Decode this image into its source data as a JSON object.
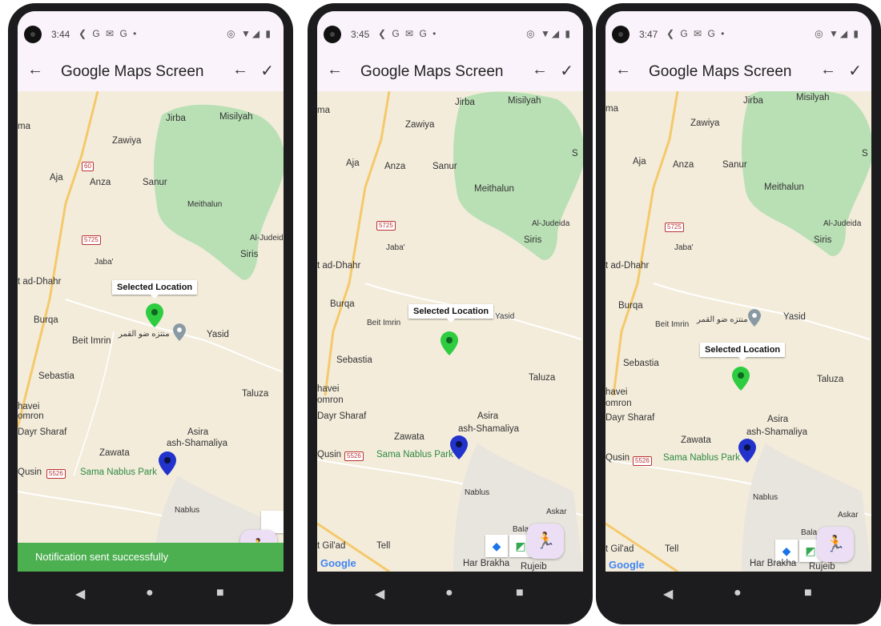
{
  "status": {
    "time1": "3:44",
    "time2": "3:45",
    "time3": "3:47",
    "left_icons": "❮ G ✉ G •",
    "right_icons": "◎ ▼◢ ▮"
  },
  "appbar": {
    "title": "Google Maps Screen",
    "back": "←",
    "back2": "←",
    "check": "✓"
  },
  "map_labels": {
    "ma": "ma",
    "jirba": "Jirba",
    "misilyah": "Misilyah",
    "zawiya": "Zawiya",
    "aja": "Aja",
    "anza": "Anza",
    "sanur": "Sanur",
    "meithalun": "Meithalun",
    "al_judeida": "Al-Judeida",
    "siris": "Siris",
    "jaba": "Jaba'",
    "t_ad_dhahr": "t ad-Dhahr",
    "burqa": "Burqa",
    "beit_imrin": "Beit Imrin",
    "arabic": "منتزه ضو القمر",
    "yasid": "Yasid",
    "sebastia": "Sebastia",
    "taluza": "Taluza",
    "havei": "havei",
    "omron": "omron",
    "dayr_sharaf": "Dayr Sharaf",
    "asira": "Asira",
    "ash_shamaliya": "ash-Shamaliya",
    "zawata": "Zawata",
    "qusin": "Qusin",
    "sama_park": "Sama Nablus Park",
    "nablus": "Nablus",
    "s": "S",
    "gilad": "t Gil'ad",
    "tell": "Tell",
    "har_brakha": "Har Brakha",
    "rujeib": "Rujeib",
    "balat": "Bala",
    "askar": "Askar",
    "hama": "hma",
    "google": "Google"
  },
  "shields": {
    "r60": "60",
    "r5725": "5725",
    "r5526": "5526"
  },
  "infowindow": {
    "selected": "Selected Location"
  },
  "toast": {
    "message": "Notification sent successfully"
  },
  "fab": {
    "icon": "🏃"
  },
  "colors": {
    "map_bg": "#f3ecdb",
    "park": "#b9e0b5",
    "road": "#f5c96b",
    "appbar": "#fbf3fb",
    "toast": "#4caf50",
    "fab": "#ecdff5",
    "pin_green": "#2ecc40",
    "pin_blue": "#2233cc"
  }
}
